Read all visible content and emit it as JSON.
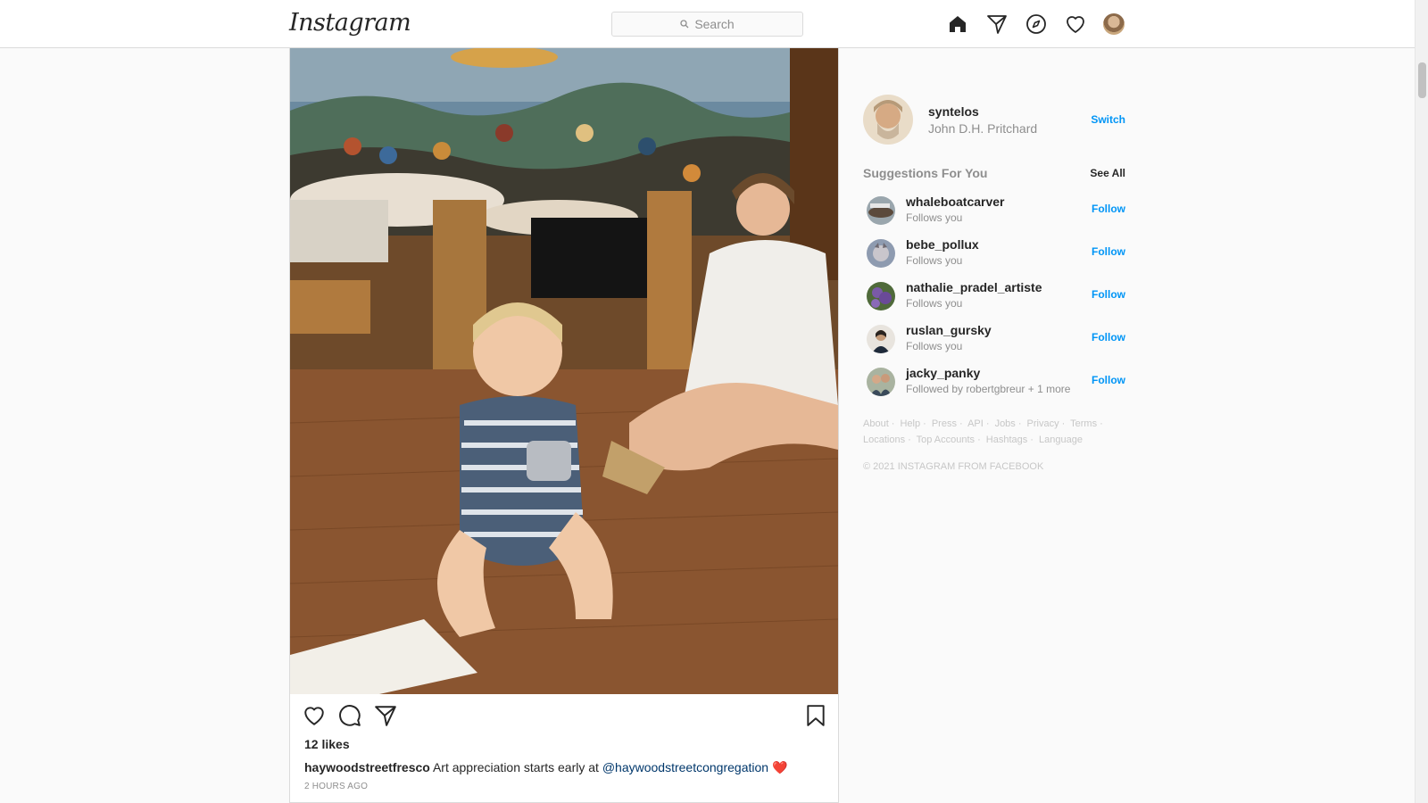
{
  "nav": {
    "logo": "Instagram",
    "search_placeholder": "Search",
    "icons": [
      "home-icon",
      "direct-icon",
      "explore-icon",
      "activity-icon",
      "profile-avatar"
    ]
  },
  "post": {
    "likes": "12 likes",
    "caption_user": "haywoodstreetfresco",
    "caption_text": "Art appreciation starts early at",
    "caption_mention": "@haywoodstreetcongregation",
    "caption_emoji": "❤️",
    "time": "2 HOURS AGO"
  },
  "sidebar": {
    "username": "syntelos",
    "fullname": "John D.H. Pritchard",
    "switch_label": "Switch",
    "suggestions_title": "Suggestions For You",
    "see_all": "See All",
    "suggestions": [
      {
        "username": "whaleboatcarver",
        "detail": "Follows you",
        "action": "Follow"
      },
      {
        "username": "bebe_pollux",
        "detail": "Follows you",
        "action": "Follow"
      },
      {
        "username": "nathalie_pradel_artiste",
        "detail": "Follows you",
        "action": "Follow"
      },
      {
        "username": "ruslan_gursky",
        "detail": "Follows you",
        "action": "Follow"
      },
      {
        "username": "jacky_panky",
        "detail": "Followed by robertgbreur + 1 more",
        "action": "Follow"
      }
    ],
    "footer_links_row1": [
      "About",
      "Help",
      "Press",
      "API",
      "Jobs",
      "Privacy",
      "Terms"
    ],
    "footer_links_row2": [
      "Locations",
      "Top Accounts",
      "Hashtags",
      "Language"
    ],
    "copyright": "© 2021 Instagram from Facebook"
  },
  "colors": {
    "accent": "#0095f6",
    "muted": "#8e8e8e",
    "border": "#dbdbdb",
    "background": "#fafafa"
  }
}
